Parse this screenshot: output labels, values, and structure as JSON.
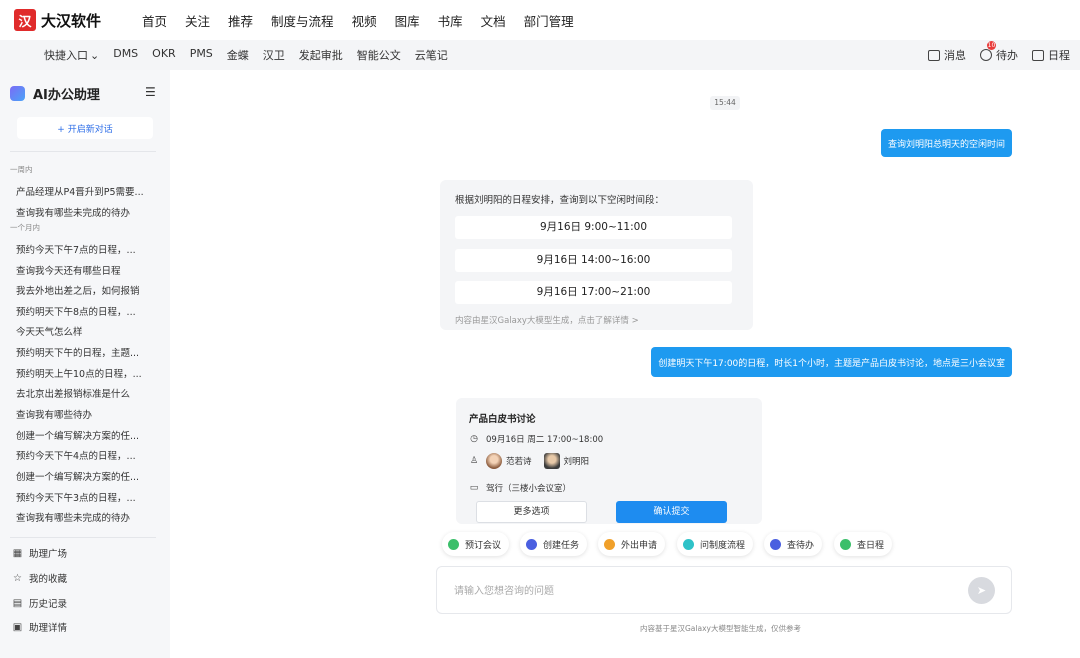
{
  "app": {
    "logo_mark": "汉",
    "name": "大汉软件"
  },
  "top_nav": [
    "首页",
    "关注",
    "推荐",
    "制度与流程",
    "视频",
    "图库",
    "书库",
    "文档",
    "部门管理"
  ],
  "sub_nav": [
    "快捷入口",
    "DMS",
    "OKR",
    "PMS",
    "金蝶",
    "汉卫",
    "发起审批",
    "智能公文",
    "云笔记"
  ],
  "sub_nav_arrow": "⌄",
  "header_right": {
    "messages": "消息",
    "todo": "待办",
    "todo_badge": "10",
    "calendar": "日程"
  },
  "sidebar": {
    "title": "AI办公助理",
    "new_chat": "+ 开启新对话",
    "group_week": "一周内",
    "group_month": "一个月内",
    "history_week": [
      "产品经理从P4晋升到P5需要...",
      "查询我有哪些未完成的待办"
    ],
    "history_month": [
      "预约今天下午7点的日程，...",
      "查询我今天还有哪些日程",
      "我去外地出差之后，如何报销",
      "预约明天下午8点的日程，...",
      "今天天气怎么样",
      "预约明天下午的日程，主题...",
      "预约明天上午10点的日程，...",
      "去北京出差报销标准是什么",
      "查询我有哪些待办",
      "创建一个编写解决方案的任...",
      "预约今天下午4点的日程，...",
      "创建一个编写解决方案的任...",
      "预约今天下午3点的日程，...",
      "查询我有哪些未完成的待办"
    ],
    "bottom": [
      {
        "icon": "grid-icon",
        "label": "助理广场"
      },
      {
        "icon": "star-icon",
        "label": "我的收藏"
      },
      {
        "icon": "history-icon",
        "label": "历史记录"
      },
      {
        "icon": "detail-icon",
        "label": "助理详情"
      }
    ]
  },
  "chat": {
    "time": "15:44",
    "user_msg_1": "查询刘明阳总明天的空闲时间",
    "reply_intro": "根据刘明阳的日程安排，查询到以下空闲时间段：",
    "slots": [
      "9月16日  9:00~11:00",
      "9月16日  14:00~16:00",
      "9月16日  17:00~21:00"
    ],
    "reply_footer": "内容由星汉Galaxy大模型生成，点击了解详情 >",
    "user_msg_2": "创建明天下午17:00的日程，时长1个小时，主题是产品白皮书讨论，地点是三小会议室",
    "event": {
      "title": "产品白皮书讨论",
      "time": "09月16日 周二 17:00~18:00",
      "attendee_1": "范若诗",
      "attendee_2": "刘明阳",
      "location": "驾行（三楼小会议室）",
      "more_button": "更多选项",
      "confirm_button": "确认提交"
    }
  },
  "quick_actions": [
    {
      "label": "预订会议",
      "color": "#3bbf6a"
    },
    {
      "label": "创建任务",
      "color": "#4a5fe0"
    },
    {
      "label": "外出申请",
      "color": "#f0a02a"
    },
    {
      "label": "问制度流程",
      "color": "#2ec2c8"
    },
    {
      "label": "查待办",
      "color": "#4a5fe0"
    },
    {
      "label": "查日程",
      "color": "#3bbf6a"
    }
  ],
  "composer": {
    "placeholder": "请输入您想咨询的问题",
    "send_icon": "send-icon"
  },
  "disclaimer": "内容基于星汉Galaxy大模型智能生成，仅供参考"
}
